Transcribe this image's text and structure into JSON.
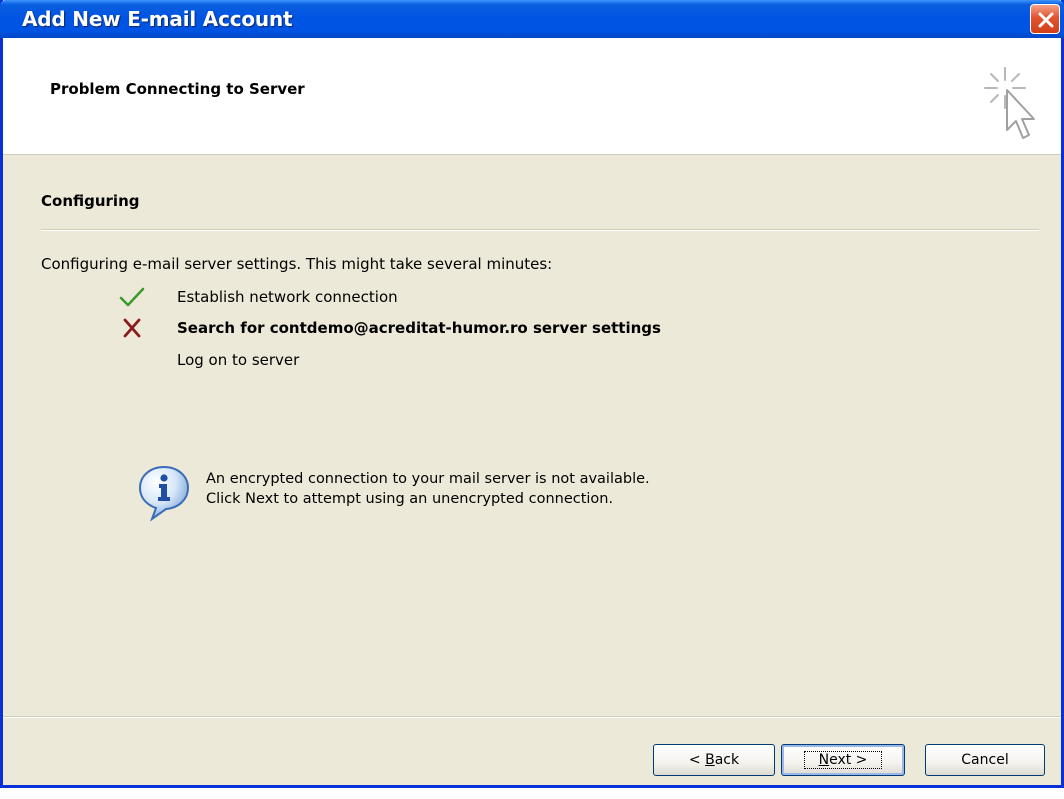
{
  "window": {
    "title": "Add New E-mail Account"
  },
  "header": {
    "title": "Problem Connecting to Server",
    "icon": "cursor-sparkle-icon"
  },
  "section": {
    "title": "Configuring",
    "description": "Configuring e-mail server settings. This might take several minutes:"
  },
  "steps": [
    {
      "label": "Establish network connection",
      "status": "done",
      "icon": "checkmark-icon",
      "color": "#3a9a2a"
    },
    {
      "label": "Search for contdemo@acreditat-humor.ro server settings",
      "status": "failed",
      "icon": "x-icon",
      "color": "#8b1a1a"
    },
    {
      "label": "Log on to server",
      "status": "pending",
      "icon": "",
      "color": ""
    }
  ],
  "info": {
    "icon": "info-balloon-icon",
    "line1": "An encrypted connection to your mail server is not available.",
    "line2": "Click Next to attempt using an unencrypted connection."
  },
  "buttons": {
    "back_prefix": "< ",
    "back_access": "B",
    "back_rest": "ack",
    "next_access": "N",
    "next_rest": "ext >",
    "cancel": "Cancel"
  },
  "theme": {
    "titlebar": "#0054e3",
    "dialog_bg": "#ece9d8",
    "close": "#e2542e"
  }
}
